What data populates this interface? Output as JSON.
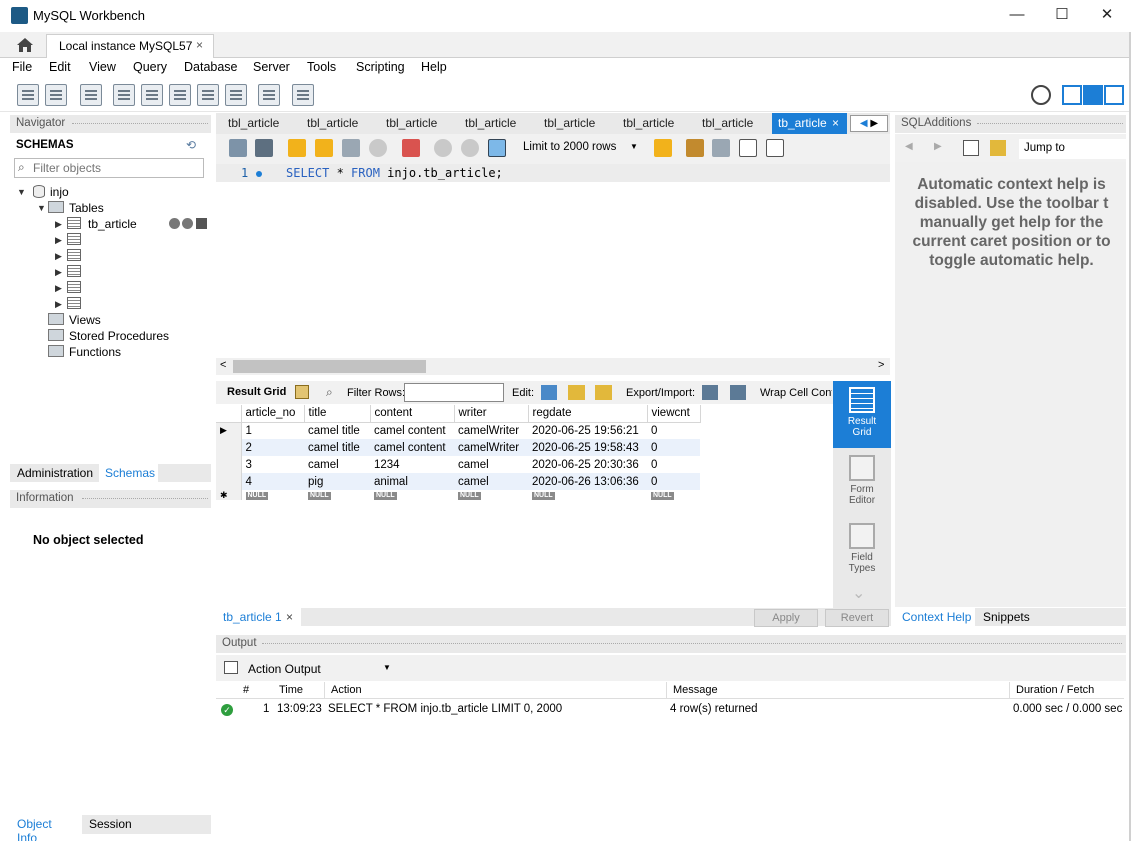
{
  "window": {
    "title": "MySQL Workbench",
    "minimize": "—",
    "maximize": "☐",
    "close": "✕"
  },
  "connection_tab": {
    "label": "Local instance MySQL57",
    "close": "×"
  },
  "menu": [
    "File",
    "Edit",
    "View",
    "Query",
    "Database",
    "Server",
    "Tools",
    "Scripting",
    "Help"
  ],
  "navigator": {
    "header": "Navigator",
    "schemas_label": "SCHEMAS",
    "filter_placeholder": "Filter objects",
    "schema_name": "injo",
    "tables_label": "Tables",
    "table_1": "tb_article",
    "views_label": "Views",
    "procedures_label": "Stored Procedures",
    "functions_label": "Functions",
    "tab_administration": "Administration",
    "tab_schemas": "Schemas",
    "information_header": "Information",
    "no_object": "No object selected",
    "tab_object_info": "Object Info",
    "tab_session": "Session"
  },
  "query_tabs": [
    "tbl_article",
    "tbl_article",
    "tbl_article",
    "tbl_article",
    "tbl_article",
    "tbl_article",
    "tbl_article",
    "tb_article"
  ],
  "active_tab_close": "×",
  "sql_toolbar": {
    "limit_select": "Limit to 2000 rows"
  },
  "editor": {
    "line_number": "1",
    "sql_keyword1": "SELECT",
    "sql_rest1": " * ",
    "sql_keyword2": "FROM",
    "sql_rest2": " injo.tb_article;"
  },
  "result_bar": {
    "result_grid": "Result Grid",
    "filter_rows": "Filter Rows:",
    "edit": "Edit:",
    "export_import": "Export/Import:",
    "wrap_cell": "Wrap Cell Conte"
  },
  "grid": {
    "columns": [
      "article_no",
      "title",
      "content",
      "writer",
      "regdate",
      "viewcnt"
    ],
    "rows": [
      [
        "1",
        "camel title",
        "camel content",
        "camelWriter",
        "2020-06-25 19:56:21",
        "0"
      ],
      [
        "2",
        "camel title",
        "camel content",
        "camelWriter",
        "2020-06-25 19:58:43",
        "0"
      ],
      [
        "3",
        "camel",
        "1234",
        "camel",
        "2020-06-25 20:30:36",
        "0"
      ],
      [
        "4",
        "pig",
        "animal",
        "camel",
        "2020-06-26 13:06:36",
        "0"
      ]
    ],
    "null_badge": "NULL"
  },
  "side_buttons": {
    "result_grid_1": "Result",
    "result_grid_2": "Grid",
    "form_editor_1": "Form",
    "form_editor_2": "Editor",
    "field_types_1": "Field",
    "field_types_2": "Types"
  },
  "result_tab": {
    "label": "tb_article 1",
    "close": "×"
  },
  "apply_button": "Apply",
  "revert_button": "Revert",
  "sql_additions": {
    "header": "SQLAdditions",
    "jump_to": "Jump to",
    "help_lines": [
      "Automatic context help is",
      "disabled. Use the toolbar t",
      "manually get help for the",
      "current caret position or to",
      "toggle automatic help."
    ],
    "tab_context_help": "Context Help",
    "tab_snippets": "Snippets"
  },
  "output": {
    "header": "Output",
    "select": "Action Output",
    "columns": [
      "#",
      "Time",
      "Action",
      "Message",
      "Duration / Fetch"
    ],
    "row": {
      "num": "1",
      "time": "13:09:23",
      "action": "SELECT * FROM injo.tb_article LIMIT 0, 2000",
      "message": "4 row(s) returned",
      "duration": "0.000 sec / 0.000 sec"
    }
  },
  "colors": {
    "accent": "#1c7ed6",
    "success": "#2e9e3e"
  }
}
